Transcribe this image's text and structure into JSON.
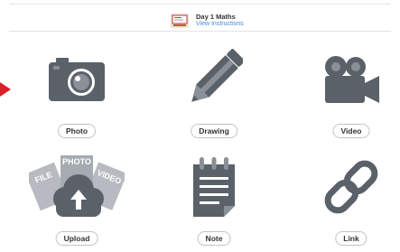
{
  "header": {
    "title": "Day 1 Maths",
    "instructions_link": "View Instructions"
  },
  "options": [
    {
      "id": "photo",
      "label": "Photo",
      "icon": "camera-icon"
    },
    {
      "id": "drawing",
      "label": "Drawing",
      "icon": "pencil-icon"
    },
    {
      "id": "video",
      "label": "Video",
      "icon": "video-camera-icon"
    },
    {
      "id": "upload",
      "label": "Upload",
      "icon": "cloud-upload-icon",
      "file_labels": [
        "FILE",
        "PHOTO",
        "VIDEO"
      ]
    },
    {
      "id": "note",
      "label": "Note",
      "icon": "notepad-icon"
    },
    {
      "id": "link",
      "label": "Link",
      "icon": "chain-link-icon"
    }
  ],
  "colors": {
    "icon": "#5a6169",
    "icon_light": "#8b9098",
    "link": "#4a8ad6",
    "arrow": "#d8202a"
  }
}
